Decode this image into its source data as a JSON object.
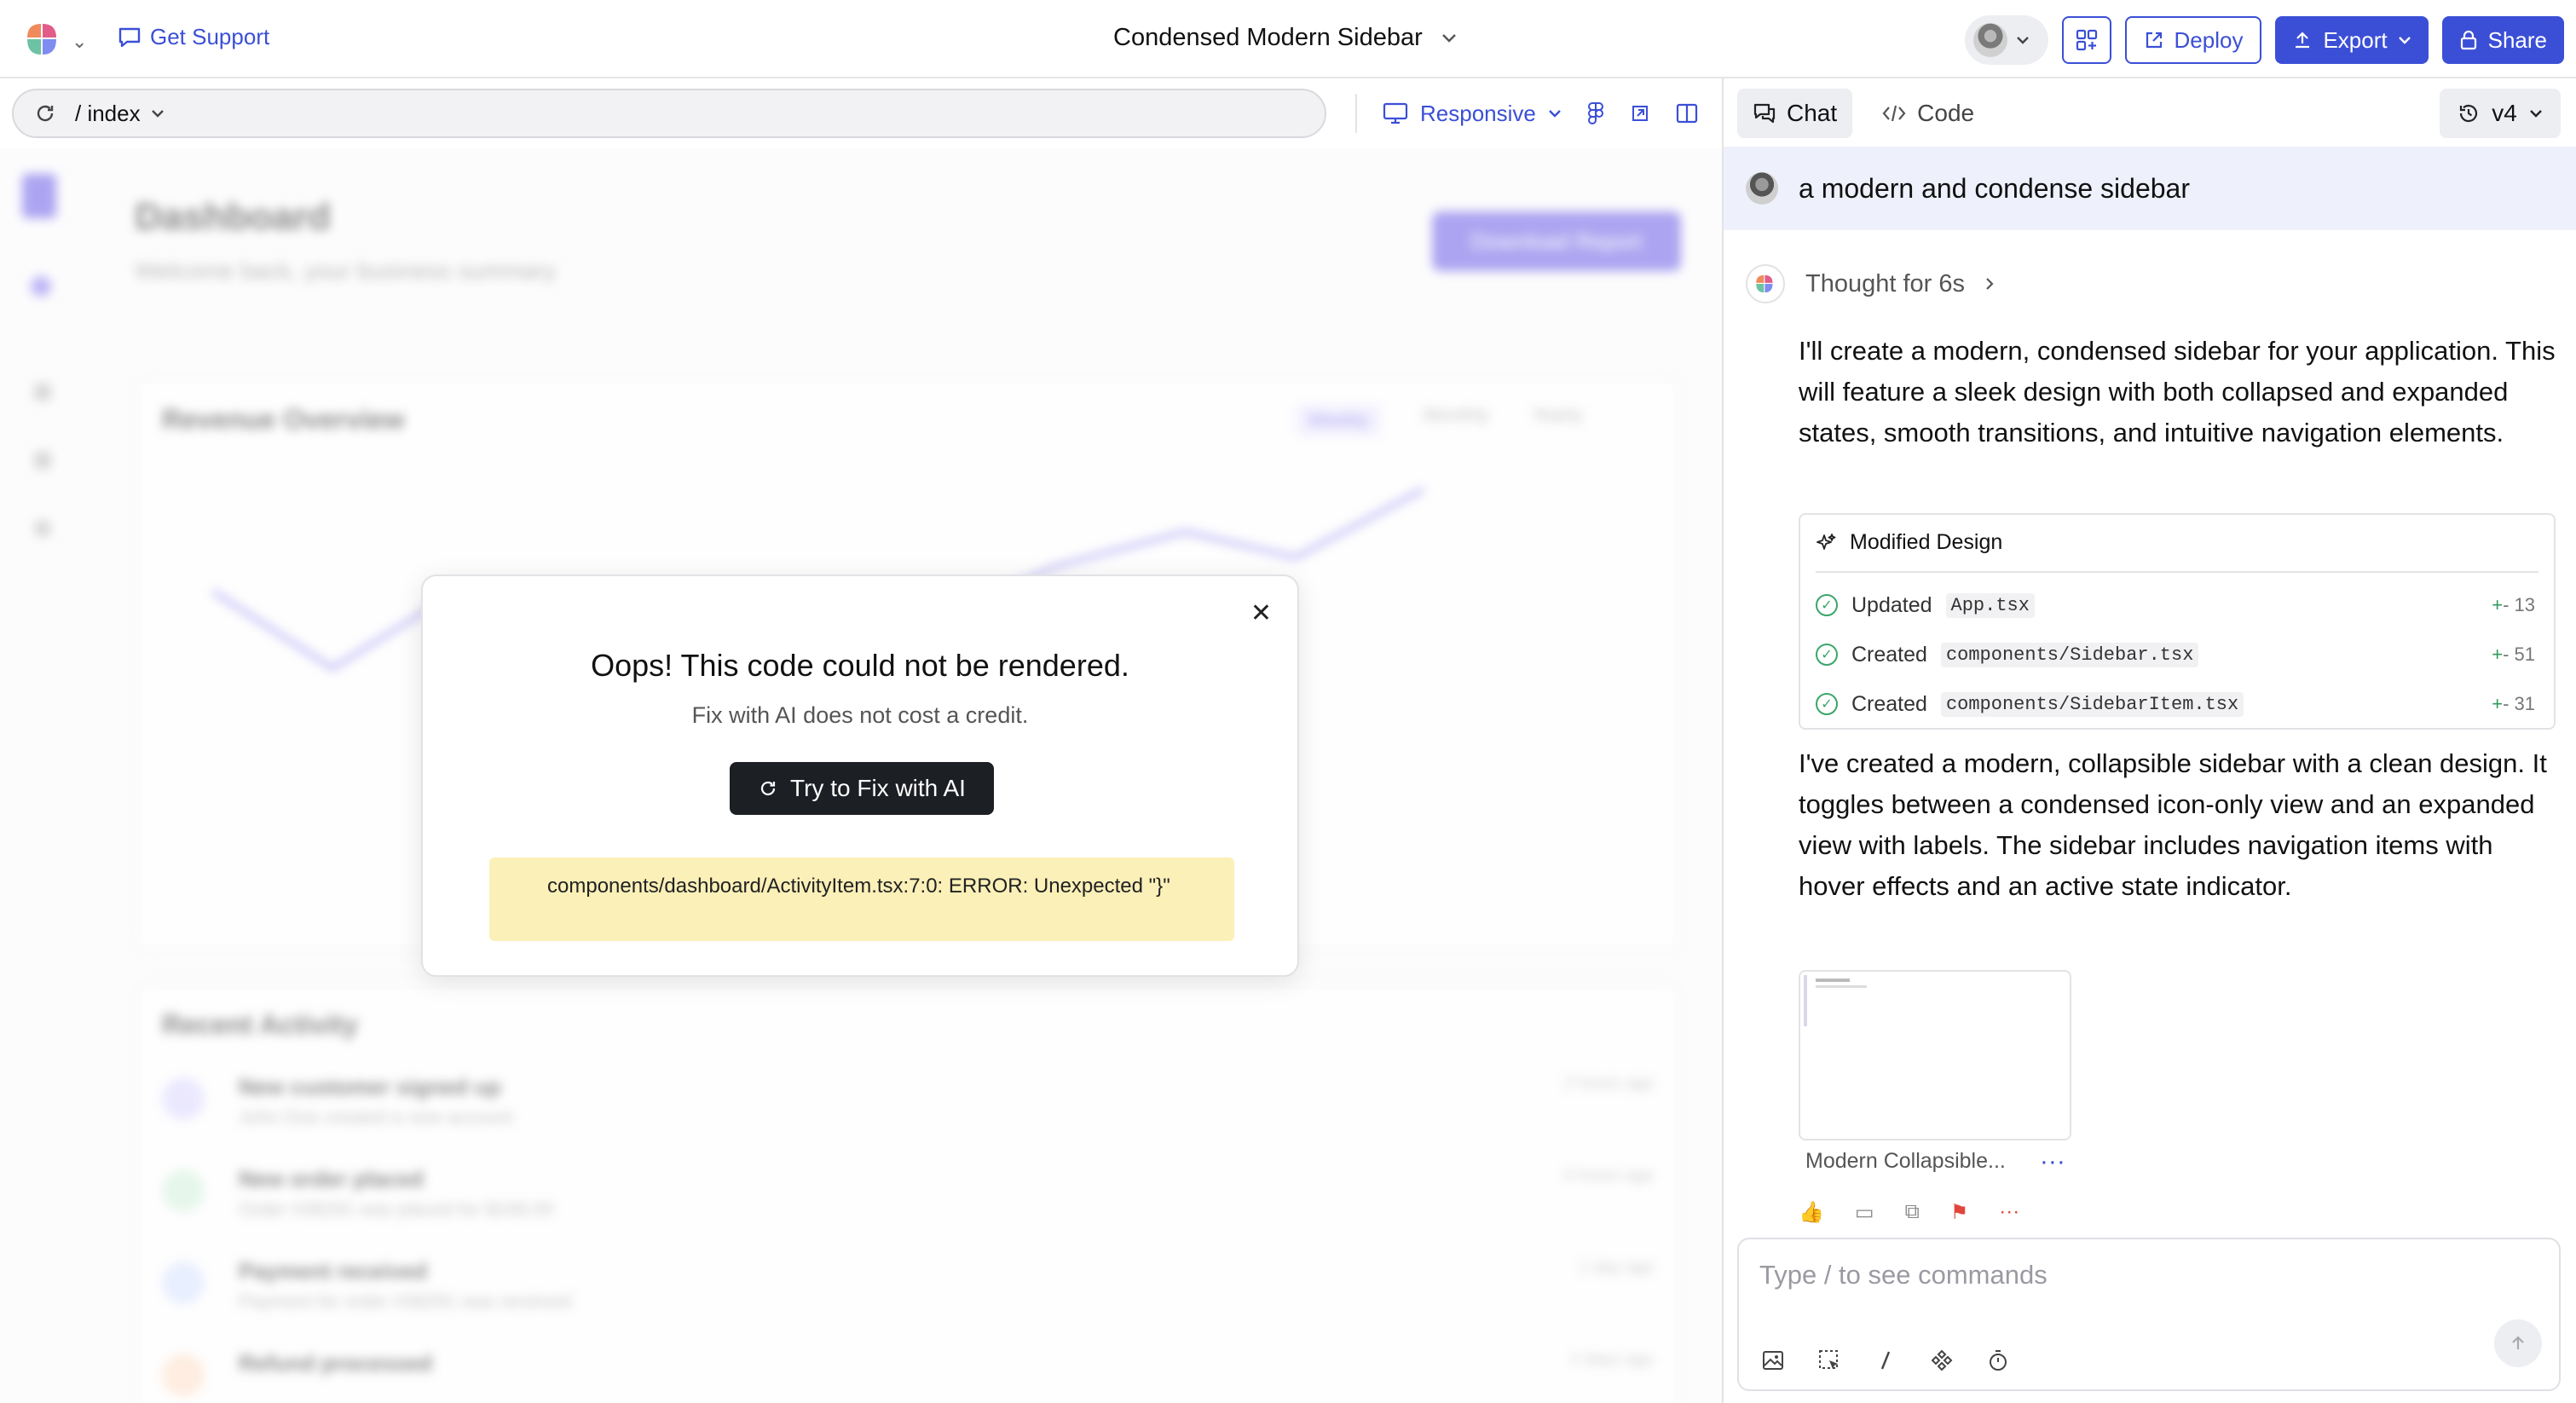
{
  "topbar": {
    "support_label": "Get Support",
    "project_title": "Condensed Modern Sidebar",
    "deploy_label": "Deploy",
    "export_label": "Export",
    "share_label": "Share"
  },
  "urlbar": {
    "path": "/ index",
    "responsive_label": "Responsive"
  },
  "preview": {
    "page_title": "Dashboard",
    "page_subtitle": "Welcome back, your business summary",
    "download_button": "Download Report",
    "revenue_title": "Revenue Overview",
    "revenue_tabs": [
      "Weekly",
      "Monthly",
      "Yearly"
    ],
    "activity_title": "Recent Activity",
    "activity_items": [
      {
        "title": "New customer signed up",
        "desc": "John Doe created a new account",
        "time": "2 hours ago"
      },
      {
        "title": "New order placed",
        "desc": "Order #38291 was placed for $248.00",
        "time": "5 hours ago"
      },
      {
        "title": "Payment received",
        "desc": "Payment for order #38291 was received",
        "time": "1 day ago"
      },
      {
        "title": "Refund processed",
        "desc": "",
        "time": "2 days ago"
      }
    ]
  },
  "modal": {
    "title": "Oops! This code could not be rendered.",
    "subtitle": "Fix with AI does not cost a credit.",
    "fix_button": "Try to Fix with AI",
    "error_text": "components/dashboard/ActivityItem.tsx:7:0: ERROR: Unexpected \"}\""
  },
  "chat": {
    "tabs": [
      "Chat",
      "Code"
    ],
    "version": "v4",
    "user_message": "a modern and condense sidebar",
    "thought": "Thought for 6s",
    "reply_1": "I'll create a modern, condensed sidebar for your application. This will feature a sleek design with both collapsed and expanded states, smooth transitions, and intuitive navigation elements.",
    "card_title": "Modified Design",
    "changes": [
      {
        "action": "Updated",
        "file": "App.tsx",
        "diff": "13"
      },
      {
        "action": "Created",
        "file": "components/Sidebar.tsx",
        "diff": "51"
      },
      {
        "action": "Created",
        "file": "components/SidebarItem.tsx",
        "diff": "31"
      }
    ],
    "reply_2": "I've created a modern, collapsible sidebar with a clean design. It toggles between a condensed icon-only view and an expanded view with labels. The sidebar includes navigation items with hover effects and an active state indicator.",
    "thumbnail_label": "Modern Collapsible...",
    "composer_placeholder": "Type / to see commands"
  },
  "colors": {
    "accent": "#3b4fd6",
    "error_bg": "#fbf0b8",
    "success": "#3aa66a"
  }
}
